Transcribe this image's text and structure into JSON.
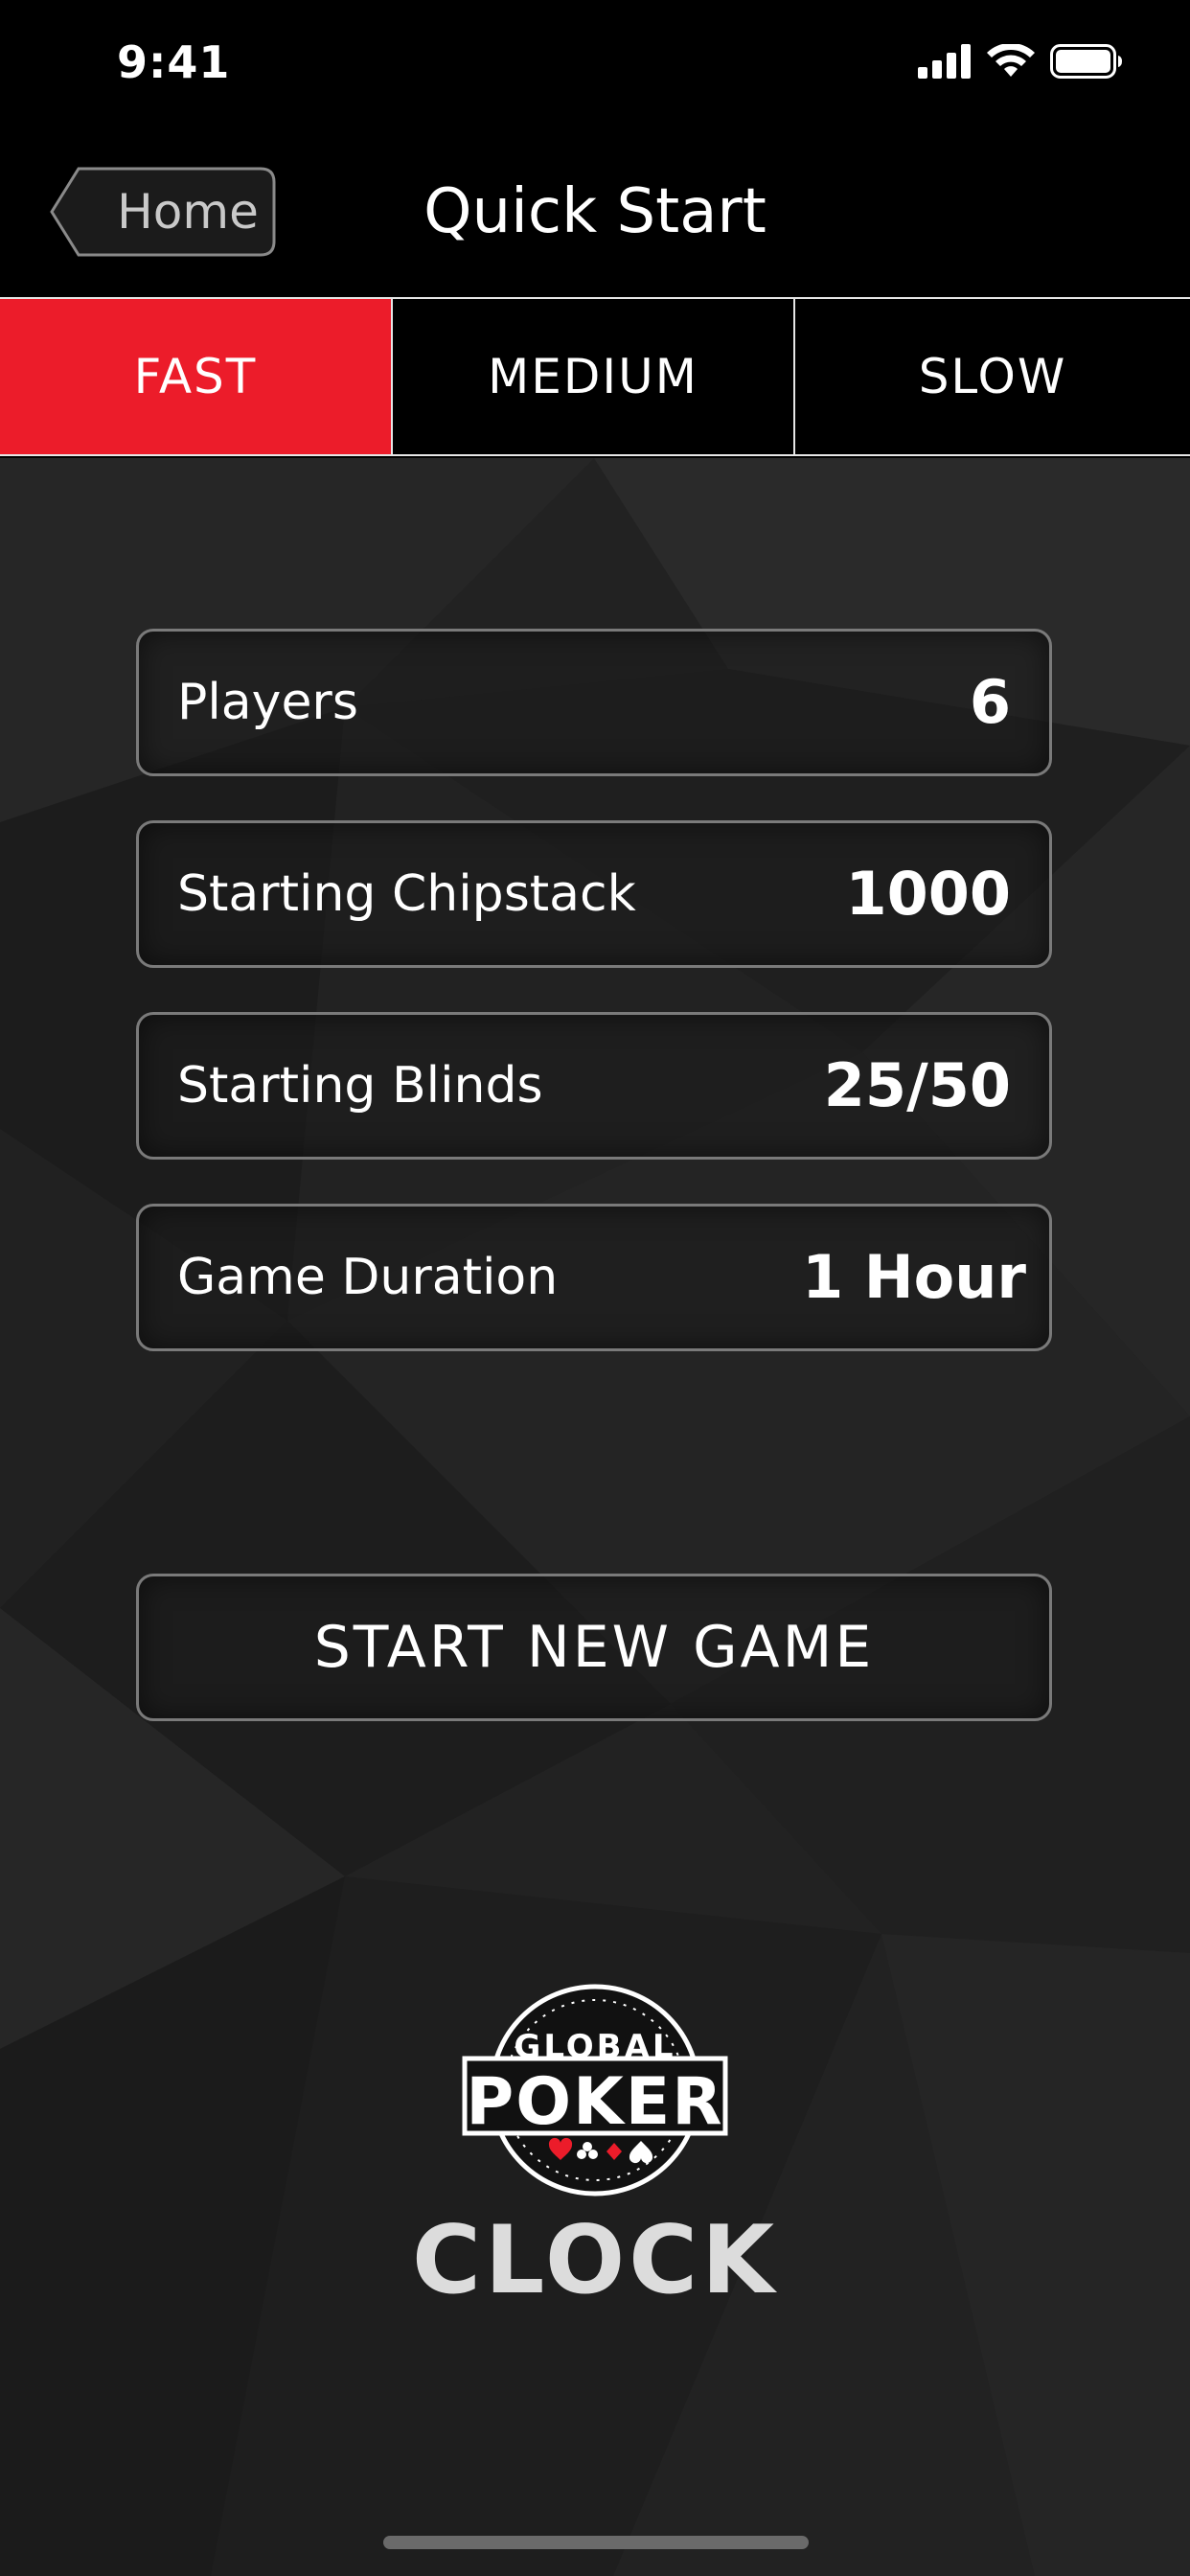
{
  "status_bar": {
    "time": "9:41"
  },
  "nav": {
    "back_label": "Home",
    "title": "Quick Start"
  },
  "speed_tabs": [
    {
      "label": "FAST",
      "selected": true
    },
    {
      "label": "MEDIUM",
      "selected": false
    },
    {
      "label": "SLOW",
      "selected": false
    }
  ],
  "settings": [
    {
      "label": "Players",
      "value": "6"
    },
    {
      "label": "Starting Chipstack",
      "value": "1000"
    },
    {
      "label": "Starting Blinds",
      "value": "25/50"
    },
    {
      "label": "Game Duration",
      "value": "1 Hour"
    }
  ],
  "start_button": "START NEW GAME",
  "logo": {
    "line1": "GLOBAL",
    "line2": "POKER",
    "line3": "CLOCK"
  },
  "colors": {
    "accent": "#ec1c2a",
    "background": "#222222",
    "nav_background": "#000000"
  },
  "icons": [
    "signal-icon",
    "wifi-icon",
    "battery-icon",
    "back-chevron-icon"
  ]
}
